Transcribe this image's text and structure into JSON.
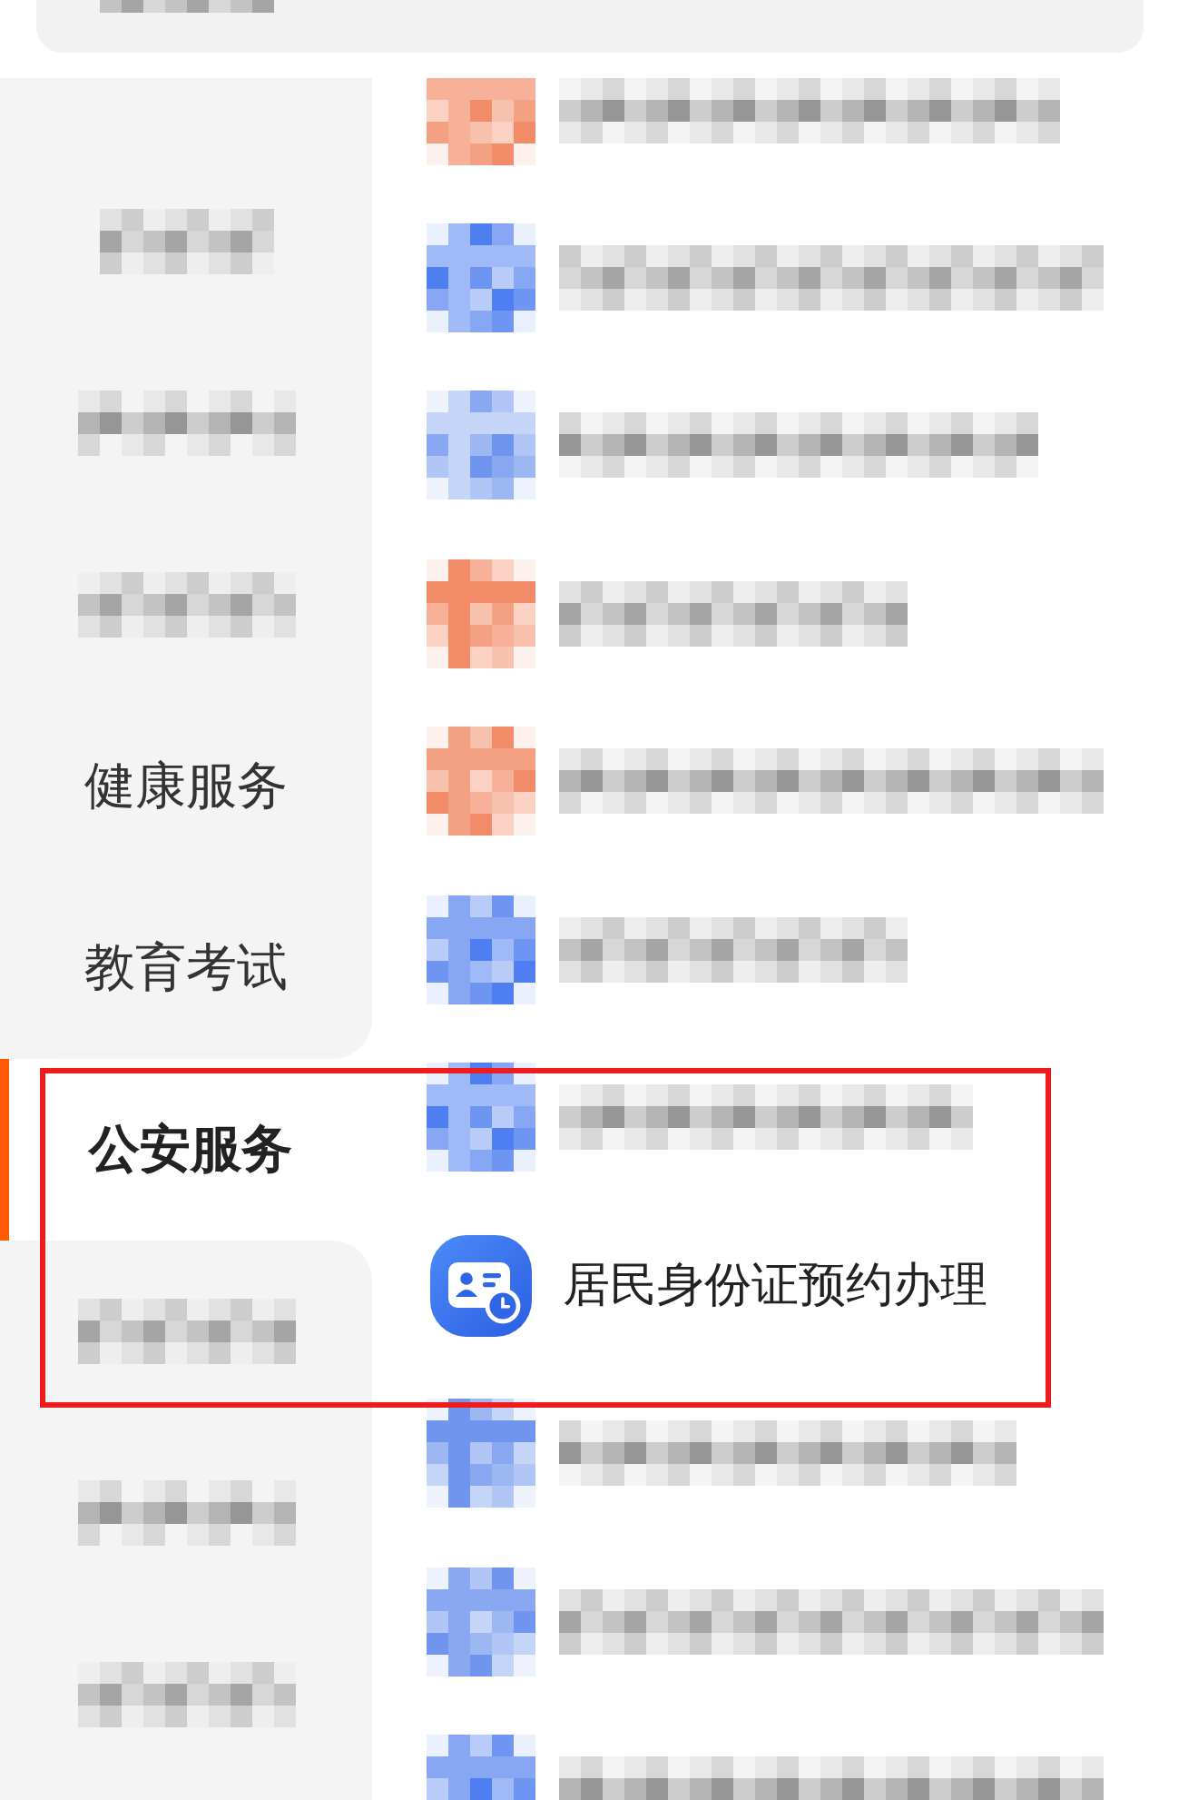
{
  "header": {
    "kind": "pixelated"
  },
  "sidebar": {
    "items": [
      {
        "kind": "pixelated",
        "selected": false
      },
      {
        "kind": "pixelated",
        "selected": false
      },
      {
        "kind": "pixelated",
        "selected": false
      },
      {
        "kind": "text",
        "label": "健康服务",
        "selected": false
      },
      {
        "kind": "text",
        "label": "教育考试",
        "selected": false
      },
      {
        "kind": "text",
        "label": "公安服务",
        "selected": true
      },
      {
        "kind": "pixelated",
        "selected": false
      },
      {
        "kind": "pixelated",
        "selected": false
      },
      {
        "kind": "pixelated",
        "selected": false
      }
    ]
  },
  "services": [
    {
      "kind": "pixelated",
      "color": "#f28c68"
    },
    {
      "kind": "pixelated",
      "color": "#4f7ef0"
    },
    {
      "kind": "pixelated",
      "color": "#6f95ee"
    },
    {
      "kind": "pixelated",
      "color": "#f28c68"
    },
    {
      "kind": "pixelated",
      "color": "#f28c68"
    },
    {
      "kind": "pixelated",
      "color": "#4f7ef0"
    },
    {
      "kind": "pixelated",
      "color": "#4f7ef0"
    },
    {
      "kind": "service",
      "title": "居民身份证预约办理"
    },
    {
      "kind": "pixelated",
      "color": "#6f95ee"
    },
    {
      "kind": "pixelated",
      "color": "#6f95ee"
    },
    {
      "kind": "pixelated",
      "color": "#4f7ef0"
    }
  ],
  "annotation": {
    "kind": "rectangle"
  }
}
